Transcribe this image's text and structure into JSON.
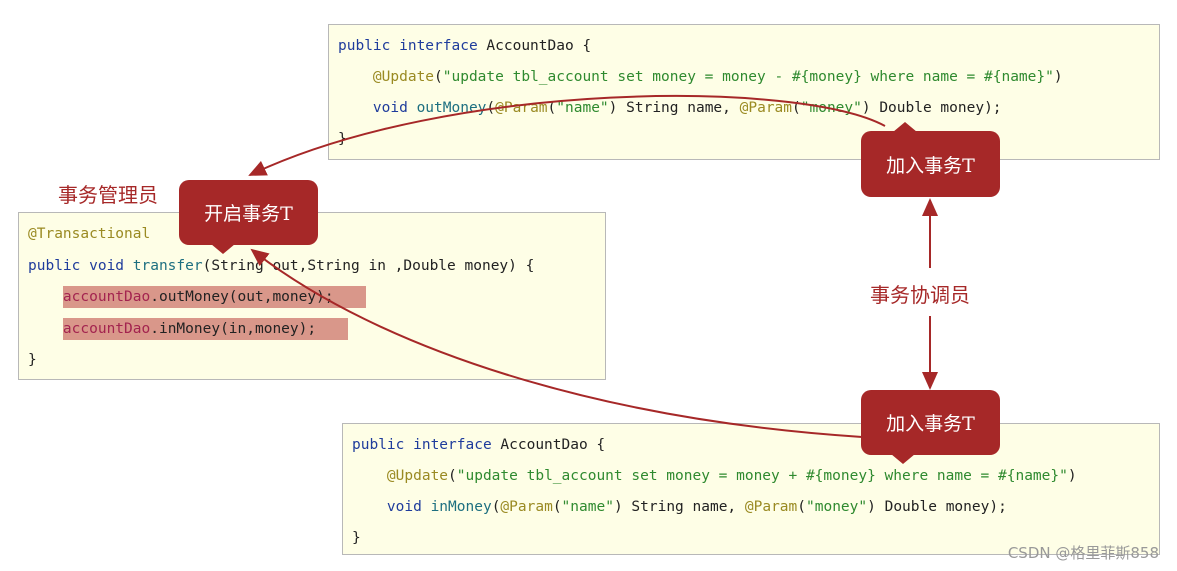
{
  "top_box": {
    "lines": [
      [
        {
          "t": "public interface ",
          "c": "kw"
        },
        {
          "t": "AccountDao {",
          "c": ""
        }
      ],
      [
        {
          "t": "    ",
          "c": ""
        },
        {
          "t": "@Update",
          "c": "an"
        },
        {
          "t": "(",
          "c": ""
        },
        {
          "t": "\"update tbl_account set money = money - #{money} where name = #{name}\"",
          "c": "st"
        },
        {
          "t": ")",
          "c": ""
        }
      ],
      [
        {
          "t": "    ",
          "c": ""
        },
        {
          "t": "void ",
          "c": "kw"
        },
        {
          "t": "outMoney",
          "c": "fn"
        },
        {
          "t": "(",
          "c": ""
        },
        {
          "t": "@Param",
          "c": "an"
        },
        {
          "t": "(",
          "c": ""
        },
        {
          "t": "\"name\"",
          "c": "st"
        },
        {
          "t": ") String name, ",
          "c": ""
        },
        {
          "t": "@Param",
          "c": "an"
        },
        {
          "t": "(",
          "c": ""
        },
        {
          "t": "\"money\"",
          "c": "st"
        },
        {
          "t": ") Double money);",
          "c": ""
        }
      ],
      [
        {
          "t": "}",
          "c": ""
        }
      ]
    ]
  },
  "left_box": {
    "lines": [
      [
        {
          "t": "@Transactional",
          "c": "an"
        }
      ],
      [
        {
          "t": "public void ",
          "c": "kw"
        },
        {
          "t": "transfer",
          "c": "fn"
        },
        {
          "t": "(String out,String in ,Double money) {",
          "c": ""
        }
      ],
      [
        {
          "t": "    ",
          "c": ""
        },
        {
          "t": "accountDao",
          "c": "dao hl0"
        },
        {
          "t": ".outMoney(out,money);",
          "c": "hl1"
        }
      ],
      [
        {
          "t": "    ",
          "c": ""
        },
        {
          "t": "accountDao",
          "c": "dao hl0"
        },
        {
          "t": ".inMoney(in,money);",
          "c": "hl1"
        }
      ],
      [
        {
          "t": "}",
          "c": ""
        }
      ]
    ]
  },
  "bottom_box": {
    "lines": [
      [
        {
          "t": "public interface ",
          "c": "kw"
        },
        {
          "t": "AccountDao {",
          "c": ""
        }
      ],
      [
        {
          "t": "    ",
          "c": ""
        },
        {
          "t": "@Update",
          "c": "an"
        },
        {
          "t": "(",
          "c": ""
        },
        {
          "t": "\"update tbl_account set money = money + #{money} where name = #{name}\"",
          "c": "st"
        },
        {
          "t": ")",
          "c": ""
        }
      ],
      [
        {
          "t": "    ",
          "c": ""
        },
        {
          "t": "void ",
          "c": "kw"
        },
        {
          "t": "inMoney",
          "c": "fn"
        },
        {
          "t": "(",
          "c": ""
        },
        {
          "t": "@Param",
          "c": "an"
        },
        {
          "t": "(",
          "c": ""
        },
        {
          "t": "\"name\"",
          "c": "st"
        },
        {
          "t": ") String name, ",
          "c": ""
        },
        {
          "t": "@Param",
          "c": "an"
        },
        {
          "t": "(",
          "c": ""
        },
        {
          "t": "\"money\"",
          "c": "st"
        },
        {
          "t": ") Double money);",
          "c": ""
        }
      ],
      [
        {
          "t": "}",
          "c": ""
        }
      ]
    ]
  },
  "labels": {
    "manager": "事务管理员",
    "coordinator": "事务协调员",
    "start_tx": "开启事务T",
    "join_tx_top": "加入事务T",
    "join_tx_bottom": "加入事务T"
  },
  "colors": {
    "accent": "#a62828",
    "code_bg": "#fefee6",
    "highlight": "#d9978a"
  },
  "watermark": "CSDN @格里菲斯858"
}
